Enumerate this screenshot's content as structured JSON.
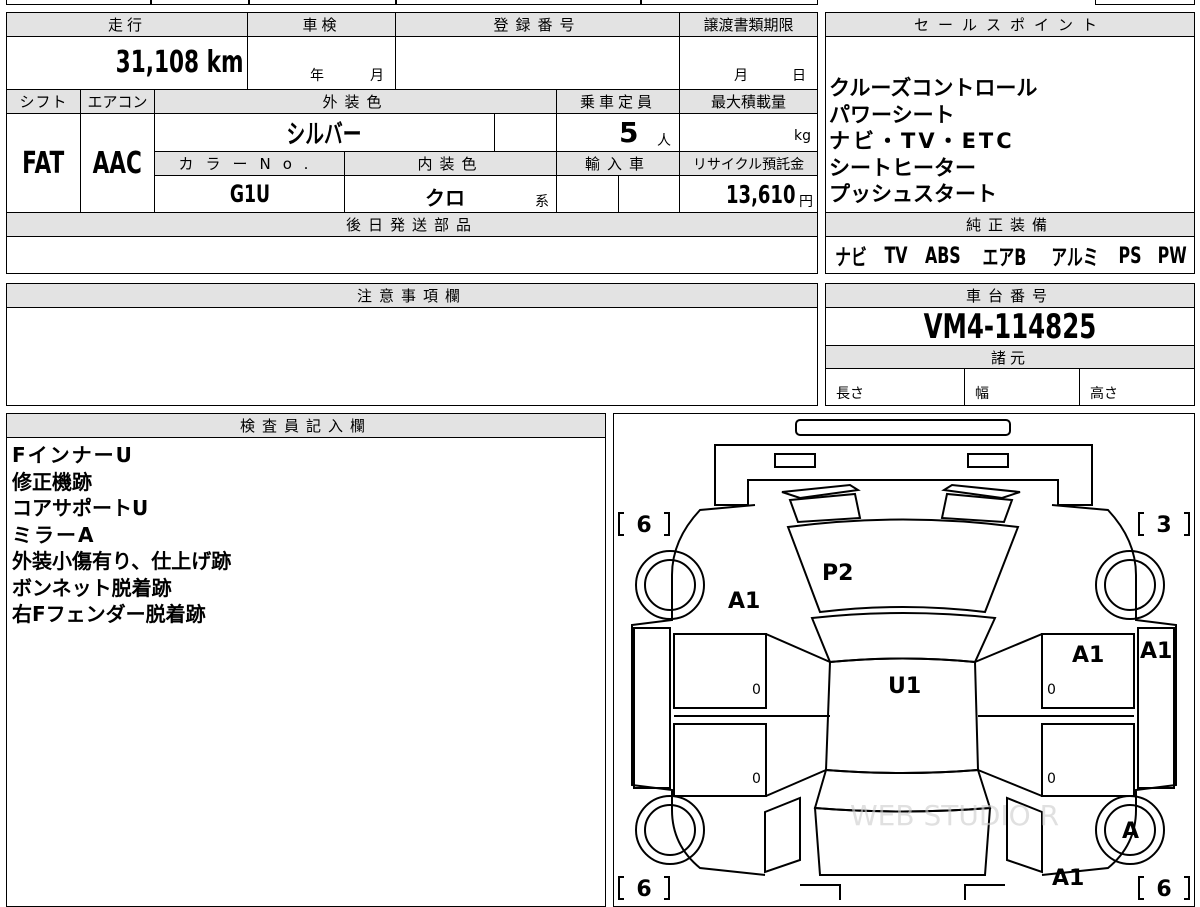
{
  "mileage": {
    "label": "走行",
    "value": "31,108",
    "unit": "km"
  },
  "inspection": {
    "label": "車検",
    "year_label": "年",
    "month_label": "月"
  },
  "registration": {
    "label": "登録番号",
    "value": ""
  },
  "transfer_deadline": {
    "label": "譲渡書類期限",
    "month_label": "月",
    "day_label": "日"
  },
  "shift": {
    "label": "シフト",
    "value": "FAT"
  },
  "aircon": {
    "label": "エアコン",
    "value": "AAC"
  },
  "exterior_color": {
    "label": "外装色",
    "value": "シルバー"
  },
  "capacity": {
    "label": "乗車定員",
    "value": "5",
    "unit": "人"
  },
  "max_load": {
    "label": "最大積載量",
    "value": "",
    "unit": "kg"
  },
  "color_no": {
    "label": "カラーNo.",
    "value": "G1U"
  },
  "interior_color": {
    "label": "内装色",
    "value": "クロ",
    "suffix": "系"
  },
  "import": {
    "label": "輸入車",
    "value": ""
  },
  "recycle": {
    "label": "リサイクル預託金",
    "value": "13,610",
    "unit": "円"
  },
  "later_parts": {
    "label": "後日発送部品",
    "value": ""
  },
  "sales_points": {
    "label": "セールスポイント",
    "items": [
      "クルーズコントロール",
      "パワーシート",
      "ナビ・TV・ETC",
      "シートヒーター",
      "プッシュスタート"
    ]
  },
  "genuine_equipment": {
    "label": "純正装備",
    "items": [
      "ナビ",
      "TV",
      "ABS",
      "エアB",
      "アルミ",
      "PS",
      "PW"
    ]
  },
  "notes": {
    "label": "注意事項欄",
    "value": ""
  },
  "chassis": {
    "label": "車台番号",
    "value": "VM4-114825"
  },
  "specs": {
    "label": "諸元",
    "length_label": "長さ",
    "width_label": "幅",
    "height_label": "高さ"
  },
  "inspector": {
    "label": "検査員記入欄",
    "lines": [
      "FインナーU",
      "修正機跡",
      "コアサポートU",
      "ミラーA",
      "外装小傷有り、仕上げ跡",
      "ボンネット脱着跡",
      "右Fフェンダー脱着跡"
    ]
  },
  "diagram": {
    "tire_front_left": "6",
    "tire_front_right": "3",
    "tire_rear_left": "6",
    "tire_rear_right": "6",
    "mark_hood": "P2",
    "mark_left_fender": "A1",
    "mark_right_fender": "A1",
    "mark_right_mirror": "A1",
    "mark_roof": "U1",
    "mark_rear_right_wheel": "A",
    "mark_rear_right": "A1",
    "door_fl": "0",
    "door_rl": "0",
    "door_fr": "0",
    "door_rr": "0",
    "watermark": "WEB STUDIO R"
  }
}
